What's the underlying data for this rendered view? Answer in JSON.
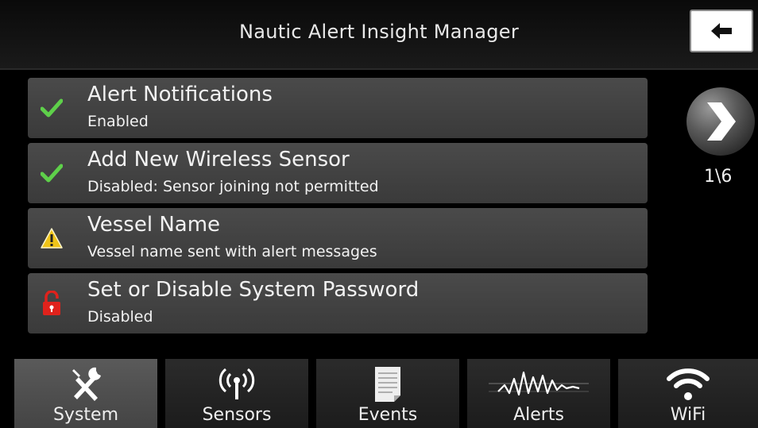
{
  "header": {
    "title": "Nautic Alert Insight Manager"
  },
  "list": {
    "items": [
      {
        "label": "Alert Notifications",
        "sub": "Enabled",
        "icon": "checkmark-icon"
      },
      {
        "label": "Add New Wireless Sensor",
        "sub": "Disabled: Sensor joining not permitted",
        "icon": "checkmark-icon"
      },
      {
        "label": "Vessel Name",
        "sub": "Vessel name sent with alert messages",
        "icon": "warning-icon"
      },
      {
        "label": "Set or Disable System Password",
        "sub": "Disabled",
        "icon": "unlocked-padlock-icon"
      }
    ]
  },
  "pager": {
    "indicator": "1\\6"
  },
  "tabs": [
    {
      "label": "System",
      "icon": "tools-icon",
      "active": true
    },
    {
      "label": "Sensors",
      "icon": "wireless-sensor-icon",
      "active": false
    },
    {
      "label": "Events",
      "icon": "document-icon",
      "active": false
    },
    {
      "label": "Alerts",
      "icon": "waveform-icon",
      "active": false
    },
    {
      "label": "WiFi",
      "icon": "wifi-icon",
      "active": false
    }
  ],
  "colors": {
    "check": "#5ed04a",
    "warning": "#f0c419",
    "lock": "#e0221c",
    "active_tab": "#555555"
  }
}
